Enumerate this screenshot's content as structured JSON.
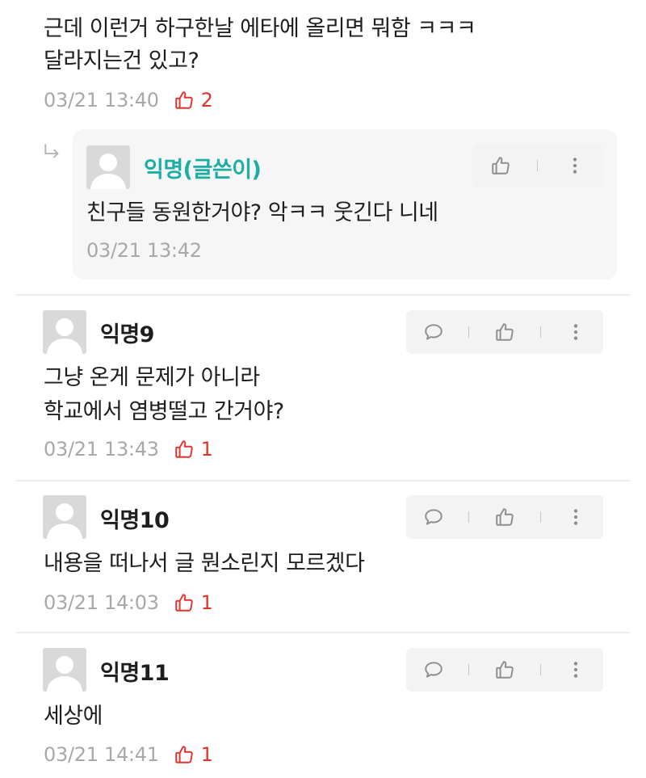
{
  "comment_top": {
    "text_line1": "근데 이런거 하구한날 에타에 올리면 뭐함 ㅋㅋㅋ",
    "text_line2": "달라지는건 있고?",
    "time": "03/21 13:40",
    "likes": "2"
  },
  "reply": {
    "author": "익명(글쓴이)",
    "text": "친구들 동원한거야? 악ㅋㅋ 웃긴다 니네",
    "time": "03/21 13:42"
  },
  "comments": [
    {
      "author": "익명9",
      "text_line1": "그냥 온게 문제가 아니라",
      "text_line2": "학교에서 염병떨고 간거야?",
      "time": "03/21 13:43",
      "likes": "1"
    },
    {
      "author": "익명10",
      "text_line1": "내용을 떠나서 글 뭔소린지 모르겠다",
      "time": "03/21 14:03",
      "likes": "1"
    },
    {
      "author": "익명11",
      "text_line1": "세상에",
      "time": "03/21 14:41",
      "likes": "1"
    }
  ],
  "colors": {
    "op_accent": "#1aaea4",
    "like_red": "#e0332c",
    "meta_gray": "#a8a8a8"
  },
  "icons": {
    "reply_arrow": "reply-arrow-icon",
    "like": "thumbs-up-icon",
    "comment": "speech-bubble-icon",
    "more": "more-vertical-icon",
    "avatar": "default-avatar-icon"
  }
}
